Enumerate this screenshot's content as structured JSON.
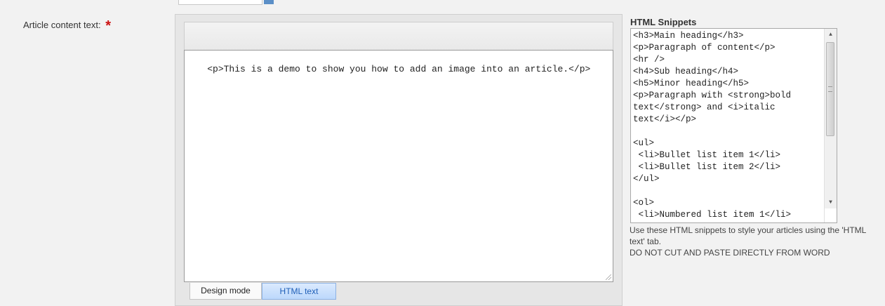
{
  "form": {
    "label": "Article content text:",
    "required_mark": "*"
  },
  "editor": {
    "content": "<p>This is a demo to show you how to add an image into an article.</p>",
    "tabs": [
      {
        "label": "Design mode",
        "active": false
      },
      {
        "label": "HTML text",
        "active": true
      }
    ]
  },
  "snippets": {
    "title": "HTML Snippets",
    "content": "<h3>Main heading</h3>\n<p>Paragraph of content</p>\n<hr />\n<h4>Sub heading</h4>\n<h5>Minor heading</h5>\n<p>Paragraph with <strong>bold\ntext</strong> and <i>italic\ntext</i></p>\n\n<ul>\n <li>Bullet list item 1</li>\n <li>Bullet list item 2</li>\n</ul>\n\n<ol>\n <li>Numbered list item 1</li>",
    "help_line1": "Use these HTML snippets to style your articles using the 'HTML text' tab.",
    "help_line2": "DO NOT CUT AND PASTE DIRECTLY FROM WORD"
  },
  "colors": {
    "required": "#cc1111",
    "active_tab_text": "#1f5fb8"
  }
}
